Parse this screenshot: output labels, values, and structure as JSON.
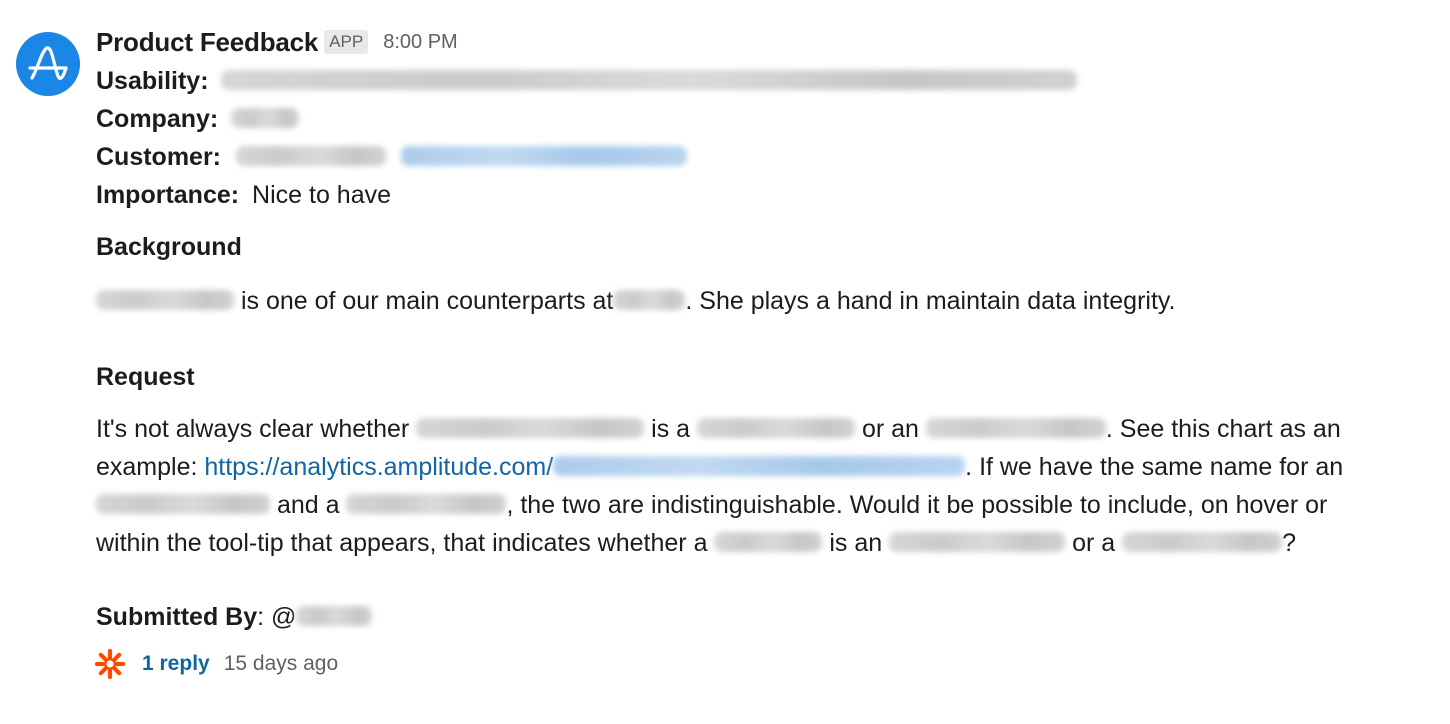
{
  "message": {
    "sender": "Product Feedback",
    "badge": "APP",
    "time": "8:00 PM",
    "fields": {
      "usability_label": "Usability:",
      "company_label": "Company:",
      "customer_label": "Customer:",
      "importance_label": "Importance:",
      "importance_value": "Nice to have"
    },
    "background": {
      "title": "Background",
      "text_1": " is one of our main counterparts at",
      "text_2": ".  She plays a hand in maintain data integrity."
    },
    "request": {
      "title": "Request",
      "l1_a": "It's not always clear whether ",
      "l1_b": " is a ",
      "l1_c": " or an ",
      "l1_d": ".  See this chart as an",
      "l2_a": "example: ",
      "l2_link": "https://analytics.amplitude.com/",
      "l2_b": ".  If we have the same name for an",
      "l3_a": " and a ",
      "l3_b": ", the two are indistinguishable.  Would it be possible to include, on hover or",
      "l4_a": "within the tool-tip that appears, that indicates whether a ",
      "l4_b": " is an ",
      "l4_c": " or a ",
      "l4_d": "?"
    },
    "submitted": {
      "label": "Submitted By",
      "colon": ": @"
    },
    "thread": {
      "reply_count": "1 reply",
      "last_reply": "15 days ago"
    }
  },
  "icons": {
    "avatar": "amplitude-logo-icon",
    "replier": "zapier-asterisk-icon"
  },
  "colors": {
    "avatar_bg": "#1a86e6",
    "link": "#1264a3",
    "replier_icon": "#ff4a00",
    "muted": "#616061"
  }
}
